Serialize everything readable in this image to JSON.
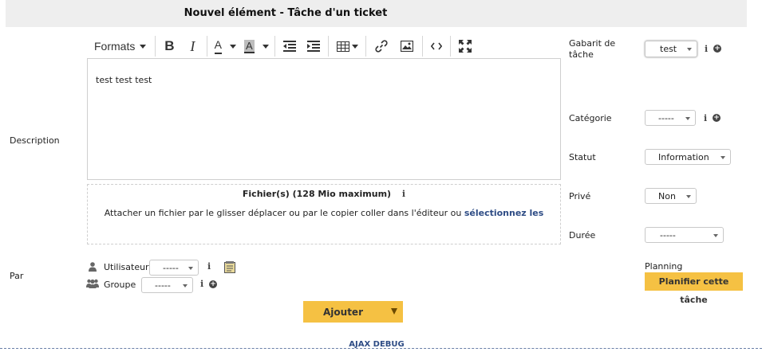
{
  "header": {
    "title": "Nouvel élément - Tâche d'un ticket"
  },
  "description": {
    "label": "Description",
    "toolbar": {
      "formats_label": "Formats",
      "bold_glyph": "B",
      "italic_glyph": "I",
      "text_color_glyph": "A",
      "bg_color_glyph": "A"
    },
    "content": "test test test"
  },
  "attachments": {
    "title": "Fichier(s) (128 Mio maximum)",
    "instruction": "Attacher un fichier par le glisser déplacer ou par le copier coller dans l'éditeur ou",
    "select_link": "sélectionnez les"
  },
  "par": {
    "label": "Par",
    "user_label": "Utilisateur",
    "user_value": "-----",
    "group_label": "Groupe",
    "group_value": "-----"
  },
  "right_panel": {
    "template_label_line1": "Gabarit de",
    "template_label_line2": "tâche",
    "template_value": "test",
    "category_label": "Catégorie",
    "category_value": "-----",
    "status_label": "Statut",
    "status_value": "Information",
    "private_label": "Privé",
    "private_value": "Non",
    "duration_label": "Durée",
    "duration_value": "-----",
    "planning_label": "Planning",
    "planning_button": "Planifier cette tâche"
  },
  "actions": {
    "add_button": "Ajouter"
  },
  "footer": {
    "debug_label": "AJAX DEBUG"
  },
  "colors": {
    "accent_yellow": "#f5c143",
    "link_blue": "#2e4c85",
    "header_gray": "#eeeeee"
  }
}
